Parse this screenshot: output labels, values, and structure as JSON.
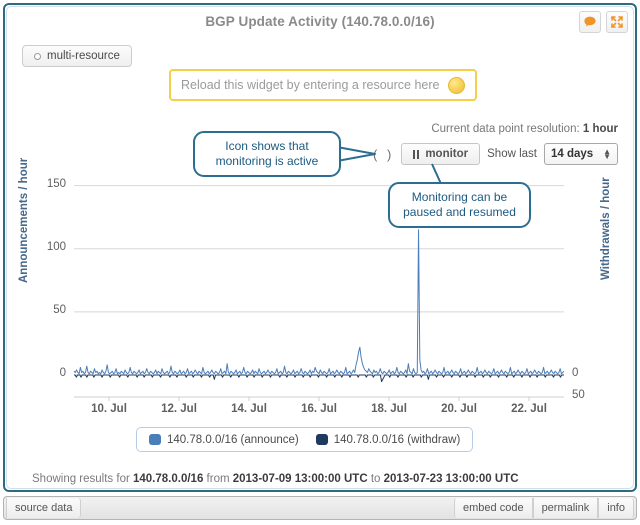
{
  "window": {
    "title": "BGP Update Activity (140.78.0.0/16)"
  },
  "header": {
    "comment_icon": "speech-bubble-icon",
    "fullscreen_icon": "expand-arrows-icon"
  },
  "multi_resource": {
    "label": "multi-resource",
    "icon": "radio-circle-icon"
  },
  "reload": {
    "placeholder": "Reload this widget by entering a resource here",
    "value": "",
    "icon": "resource-lookup-icon",
    "border_color": "#f5cf4a"
  },
  "controls": {
    "resolution_prefix": "Current data point resolution:",
    "resolution_value": "1 hour",
    "spinner": "( )",
    "monitor_label": "monitor",
    "monitor_icon": "pause-icon",
    "show_last_label": "Show last",
    "show_last_value": "14 days",
    "show_last_options": [
      "14 days"
    ]
  },
  "callouts": [
    {
      "id": "monitoring-active",
      "text": "Icon shows that monitoring is active"
    },
    {
      "id": "pause-resume",
      "text": "Monitoring can be paused and resumed"
    }
  ],
  "chart_data": {
    "type": "line",
    "title": "BGP Update Activity (140.78.0.0/16)",
    "xlabel": "",
    "ylabel": "Announcements / hour",
    "ylabel_right": "Withdrawals / hour",
    "ylim": [
      0,
      160
    ],
    "ylim_right": [
      0,
      50
    ],
    "yticks": [
      0,
      50,
      100,
      150
    ],
    "yticks_right": [
      0,
      50
    ],
    "grid": true,
    "legend_position": "bottom",
    "xticks": [
      "10. Jul",
      "12. Jul",
      "14. Jul",
      "16. Jul",
      "18. Jul",
      "20. Jul",
      "22. Jul"
    ],
    "x_start": "2013-07-09 13:00:00 UTC",
    "x_end": "2013-07-23 13:00:00 UTC",
    "series": [
      {
        "name": "140.78.0.0/16 (announce)",
        "color": "#4a7ebb",
        "axis": "left",
        "values": [
          3,
          2,
          4,
          2,
          1,
          6,
          2,
          3,
          1,
          2,
          7,
          2,
          1,
          3,
          2,
          1,
          5,
          2,
          3,
          1,
          2,
          1,
          4,
          2,
          1,
          3,
          8,
          2,
          1,
          2,
          3,
          1,
          2,
          5,
          1,
          2,
          1,
          3,
          2,
          1,
          4,
          2,
          1,
          2,
          6,
          2,
          1,
          3,
          2,
          1,
          2,
          4,
          1,
          2,
          3,
          1,
          2,
          5,
          2,
          1,
          3,
          2,
          1,
          2,
          4,
          1,
          3,
          2,
          1,
          5,
          2,
          1,
          2,
          3,
          1,
          2,
          7,
          2,
          1,
          3,
          2,
          1,
          2,
          4,
          1,
          2,
          3,
          1,
          2,
          5,
          1,
          2,
          3,
          1,
          2,
          4,
          2,
          1,
          3,
          2,
          1,
          6,
          2,
          1,
          2,
          3,
          1,
          2,
          4,
          2,
          1,
          3,
          2,
          1,
          2,
          5,
          1,
          2,
          3,
          1,
          9,
          2,
          1,
          3,
          2,
          1,
          2,
          4,
          1,
          2,
          3,
          1,
          2,
          6,
          2,
          1,
          3,
          2,
          1,
          2,
          4,
          1,
          3,
          2,
          1,
          5,
          2,
          1,
          2,
          3,
          1,
          2,
          4,
          2,
          1,
          3,
          2,
          1,
          2,
          5,
          1,
          2,
          3,
          1,
          2,
          7,
          2,
          1,
          3,
          2,
          1,
          2,
          4,
          1,
          2,
          3,
          1,
          2,
          5,
          2,
          1,
          3,
          2,
          1,
          2,
          4,
          1,
          3,
          2,
          6,
          3,
          2,
          1,
          4,
          2,
          1,
          3,
          2,
          1,
          2,
          5,
          1,
          2,
          3,
          1,
          2,
          4,
          2,
          1,
          3,
          2,
          1,
          2,
          6,
          1,
          2,
          3,
          1,
          2,
          4,
          2,
          8,
          12,
          18,
          22,
          14,
          9,
          6,
          4,
          3,
          2,
          5,
          3,
          2,
          1,
          4,
          2,
          3,
          1,
          2,
          5,
          2,
          1,
          3,
          2,
          1,
          2,
          4,
          1,
          2,
          3,
          1,
          2,
          6,
          2,
          1,
          3,
          2,
          1,
          2,
          4,
          1,
          9,
          3,
          2,
          1,
          5,
          2,
          1,
          2,
          115,
          12,
          4,
          2,
          3,
          1,
          2,
          5,
          1,
          2,
          3,
          1,
          2,
          4,
          2,
          1,
          3,
          2,
          1,
          2,
          6,
          1,
          2,
          3,
          1,
          2,
          4,
          2,
          1,
          3,
          2,
          1,
          2,
          5,
          1,
          2,
          3,
          1,
          2,
          4,
          2,
          1,
          3,
          2,
          1,
          2,
          6,
          1,
          2,
          3,
          1,
          2,
          4,
          2,
          1,
          3,
          2,
          1,
          2,
          5,
          1,
          2,
          3,
          1,
          2,
          4,
          2,
          1,
          3,
          2,
          1,
          2,
          6,
          1,
          2,
          3,
          1,
          2,
          4,
          2,
          1,
          3,
          2,
          1,
          2,
          5,
          1,
          2,
          3,
          1,
          2,
          4,
          2,
          1,
          3,
          2,
          1,
          2,
          6,
          1,
          2,
          3,
          1,
          2,
          4,
          2,
          1,
          3,
          2,
          1,
          2,
          5,
          1,
          2,
          3
        ]
      },
      {
        "name": "140.78.0.0/16 (withdraw)",
        "color": "#1f3a5f",
        "axis": "right",
        "values": [
          0,
          0,
          1,
          0,
          0,
          0,
          1,
          0,
          0,
          0,
          0,
          1,
          0,
          0,
          0,
          0,
          0,
          1,
          0,
          0,
          0,
          0,
          0,
          0,
          1,
          0,
          0,
          0,
          0,
          0,
          0,
          1,
          0,
          0,
          0,
          0,
          0,
          0,
          0,
          1,
          0,
          0,
          0,
          0,
          0,
          0,
          1,
          0,
          0,
          0,
          0,
          0,
          0,
          0,
          1,
          0,
          0,
          0,
          0,
          0,
          1,
          0,
          0,
          0,
          0,
          0,
          0,
          1,
          0,
          0,
          0,
          0,
          0,
          0,
          1,
          0,
          0,
          0,
          0,
          0,
          0,
          0,
          1,
          0,
          0,
          0,
          0,
          0,
          1,
          0,
          0,
          0,
          0,
          0,
          0,
          0,
          1,
          0,
          0,
          0,
          0,
          0,
          1,
          0,
          0,
          0,
          0,
          0,
          0,
          1,
          0,
          0,
          0,
          0,
          0,
          0,
          1,
          0,
          0,
          0,
          2,
          0,
          0,
          0,
          0,
          0,
          0,
          1,
          0,
          0,
          0,
          0,
          0,
          0,
          1,
          0,
          0,
          0,
          0,
          0,
          0,
          1,
          0,
          0,
          0,
          0,
          0,
          0,
          1,
          0,
          0,
          0,
          0,
          0,
          1,
          0,
          0,
          0,
          0,
          0,
          0,
          1,
          0,
          0,
          0,
          0,
          0,
          0,
          1,
          0,
          0,
          0,
          0,
          0,
          0,
          0,
          1,
          0,
          0,
          0,
          0,
          0,
          1,
          0,
          0,
          0,
          0,
          0,
          0,
          1,
          0,
          0,
          0,
          0,
          0,
          0,
          1,
          0,
          0,
          0,
          0,
          0,
          1,
          0,
          0,
          0,
          0,
          0,
          0,
          1,
          0,
          0,
          0,
          0,
          0,
          0,
          1,
          0,
          0,
          0,
          0,
          0,
          0,
          1,
          0,
          0,
          0,
          0,
          0,
          1,
          0,
          0,
          0,
          0,
          0,
          0,
          1,
          0,
          0,
          0,
          0,
          0,
          0,
          1,
          0,
          0,
          0,
          0,
          0,
          0,
          1,
          0,
          0,
          0,
          0,
          0,
          1,
          0,
          0,
          0,
          0,
          0,
          0,
          3,
          2,
          1,
          0,
          0,
          0,
          0,
          1,
          0,
          0,
          0,
          0,
          0,
          0,
          1,
          0,
          0,
          0,
          0,
          0,
          0,
          1,
          0,
          0,
          0,
          0,
          0,
          1,
          0,
          0,
          0,
          0,
          0,
          0,
          1,
          0,
          0,
          0,
          0,
          0,
          2,
          0,
          0,
          0,
          0,
          0,
          0,
          1,
          0,
          0,
          0,
          0,
          0,
          1,
          0,
          0,
          0,
          0,
          0,
          0,
          1,
          0,
          0,
          0,
          0,
          0,
          0,
          1,
          0,
          0,
          0,
          0,
          0,
          1,
          0,
          0,
          0,
          0,
          0,
          0,
          1,
          0,
          0,
          0,
          0,
          0,
          0,
          1,
          0,
          0,
          0,
          0,
          0,
          1,
          0,
          0,
          0,
          0,
          0,
          0,
          1,
          0,
          0,
          0,
          0,
          0,
          0,
          1,
          0,
          0,
          0,
          0,
          0,
          1,
          0,
          0,
          0,
          0,
          0,
          0,
          1,
          0,
          0,
          0,
          0,
          0,
          0,
          1,
          0,
          0,
          0,
          0,
          0,
          1,
          0,
          0,
          0,
          0,
          0,
          0,
          1,
          0,
          0,
          0,
          0,
          0,
          0,
          1,
          0,
          0,
          0,
          0,
          0,
          1,
          0,
          0,
          0
        ]
      }
    ]
  },
  "status": {
    "prefix": "Showing results for",
    "resource": "140.78.0.0/16",
    "from_label": "from",
    "from_value": "2013-07-09 13:00:00 UTC",
    "to_label": "to",
    "to_value": "2013-07-23 13:00:00 UTC"
  },
  "bottom_bar": {
    "source_data": "source data",
    "embed_code": "embed code",
    "permalink": "permalink",
    "info": "info"
  }
}
